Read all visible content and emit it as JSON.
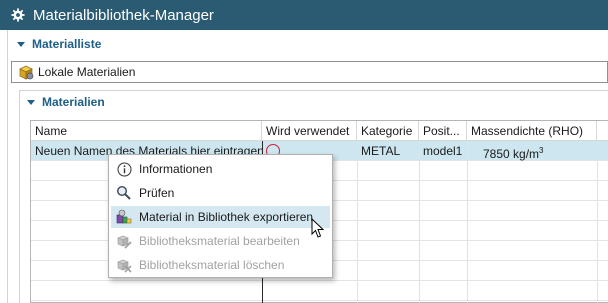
{
  "window": {
    "title": "Materialbibliothek-Manager"
  },
  "sections": {
    "library_list": {
      "label": "Materialliste"
    },
    "library_select": {
      "value": "Lokale Materialien"
    },
    "materials": {
      "label": "Materialien"
    }
  },
  "table": {
    "columns": [
      "Name",
      "Wird verwendet",
      "Kategorie",
      "Posit...",
      "Massendichte (RHO)"
    ],
    "rows": [
      {
        "name": "Neuen Namen des Materials hier eintragen",
        "in_use_icon": "red-circle-icon",
        "category": "METAL",
        "position": "model1",
        "density_value": "7850 kg/m",
        "density_exp": "3"
      }
    ]
  },
  "context_menu": {
    "items": [
      {
        "label": "Informationen",
        "icon": "info-icon",
        "enabled": true
      },
      {
        "label": "Prüfen",
        "icon": "magnifier-icon",
        "enabled": true
      },
      {
        "label": "Material in Bibliothek exportieren",
        "icon": "export-material-icon",
        "enabled": true,
        "highlighted": true
      },
      {
        "label": "Bibliotheksmaterial bearbeiten",
        "icon": "edit-material-icon",
        "enabled": false
      },
      {
        "label": "Bibliotheksmaterial löschen",
        "icon": "delete-material-icon",
        "enabled": false
      }
    ]
  },
  "colors": {
    "titlebar": "#2a5b73",
    "section_header": "#1d5f86",
    "selected_row": "#cde6ef",
    "menu_hover": "#d5e8f1",
    "status_red": "#d11f3c"
  }
}
